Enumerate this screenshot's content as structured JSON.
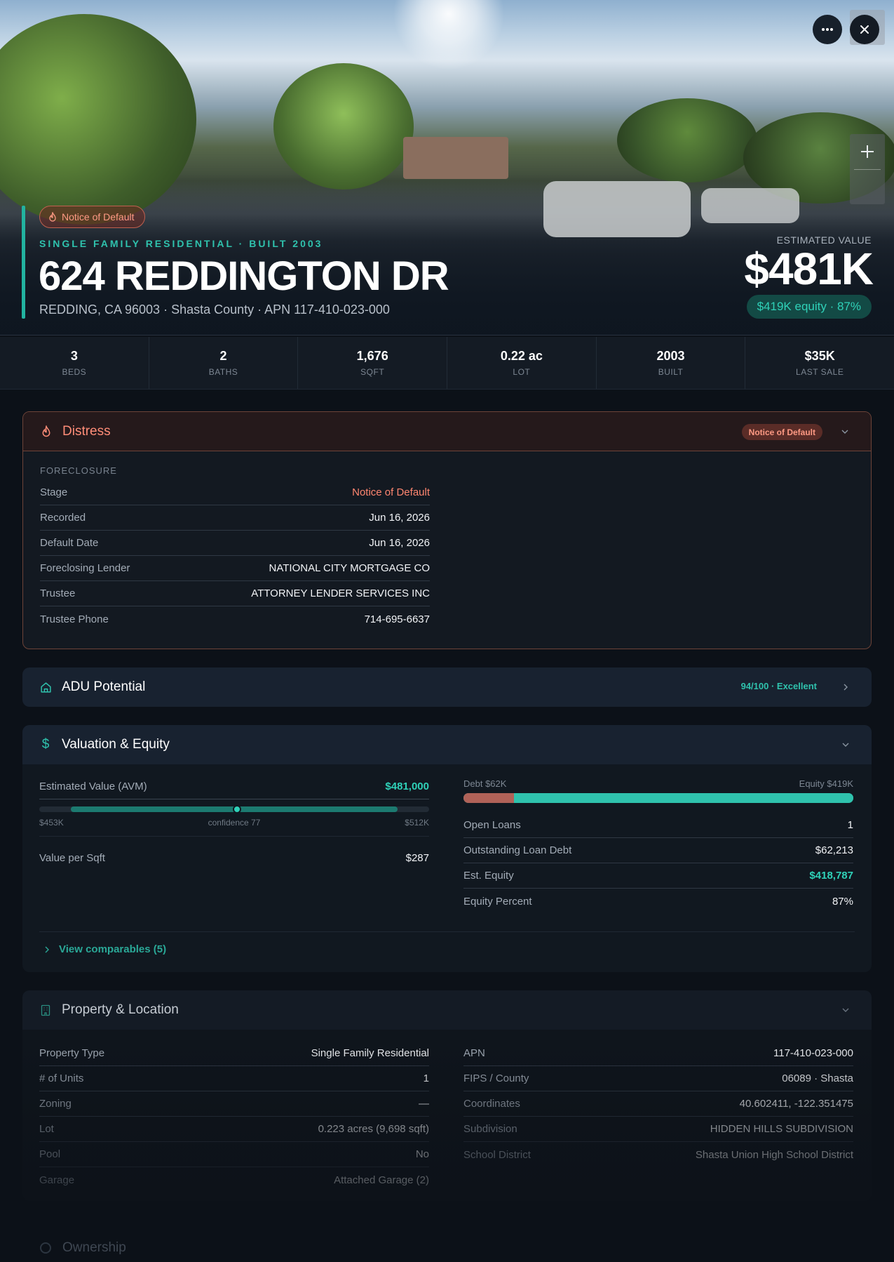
{
  "hero": {
    "distress_badge": "Notice of Default",
    "type_line": "SINGLE FAMILY RESIDENTIAL · BUILT 2003",
    "address": "624 REDDINGTON DR",
    "subline": "REDDING, CA 96003 · Shasta County · APN 117-410-023-000",
    "estimated_label": "ESTIMATED VALUE",
    "estimated_value": "$481K",
    "equity_pill": "$419K equity · 87%",
    "more_icon": "more-horizontal-icon",
    "close_icon": "close-icon",
    "zoom_in_icon": "plus-icon"
  },
  "stats": [
    {
      "value": "3",
      "label": "BEDS"
    },
    {
      "value": "2",
      "label": "BATHS"
    },
    {
      "value": "1,676",
      "label": "SQFT"
    },
    {
      "value": "0.22 ac",
      "label": "LOT"
    },
    {
      "value": "2003",
      "label": "BUILT"
    },
    {
      "value": "$35K",
      "label": "LAST SALE"
    }
  ],
  "distress": {
    "title": "Distress",
    "icon": "flame-icon",
    "badge": "Notice of Default",
    "section": "FORECLOSURE",
    "rows": [
      {
        "k": "Stage",
        "v": "Notice of Default"
      },
      {
        "k": "Recorded",
        "v": "Jun 16, 2026"
      },
      {
        "k": "Default Date",
        "v": "Jun 16, 2026"
      },
      {
        "k": "Foreclosing Lender",
        "v": "NATIONAL CITY MORTGAGE CO"
      },
      {
        "k": "Trustee",
        "v": "ATTORNEY LENDER SERVICES INC"
      },
      {
        "k": "Trustee Phone",
        "v": "714-695-6637"
      }
    ]
  },
  "adu": {
    "title": "ADU Potential",
    "icon": "home-icon",
    "score": "94/100 · Excellent"
  },
  "valuation": {
    "title": "Valuation & Equity",
    "icon": "dollar-icon",
    "avm_label": "Estimated Value (AVM)",
    "avm_value": "$481,000",
    "range_low": "$453K",
    "range_high": "$512K",
    "confidence": "confidence 77",
    "value_per_sqft_label": "Value per Sqft",
    "value_per_sqft": "$287",
    "debt_label": "Debt $62K",
    "equity_label": "Equity $419K",
    "equity_fraction": 0.87,
    "rows": [
      {
        "k": "Open Loans",
        "v": "1"
      },
      {
        "k": "Outstanding Loan Debt",
        "v": "$62,213"
      },
      {
        "k": "Est. Equity",
        "v": "$418,787"
      },
      {
        "k": "Equity Percent",
        "v": "87%"
      }
    ],
    "comparables_link": "View comparables (5)"
  },
  "property": {
    "title": "Property & Location",
    "icon": "building-icon",
    "left": [
      {
        "k": "Property Type",
        "v": "Single Family Residential"
      },
      {
        "k": "# of Units",
        "v": "1"
      },
      {
        "k": "Zoning",
        "v": "—"
      },
      {
        "k": "Lot",
        "v": "0.223 acres (9,698 sqft)"
      },
      {
        "k": "Pool",
        "v": "No"
      },
      {
        "k": "Garage",
        "v": "Attached Garage (2)"
      }
    ],
    "right": [
      {
        "k": "APN",
        "v": "117-410-023-000"
      },
      {
        "k": "FIPS / County",
        "v": "06089 · Shasta"
      },
      {
        "k": "Coordinates",
        "v": "40.602411, -122.351475"
      },
      {
        "k": "Subdivision",
        "v": "HIDDEN HILLS SUBDIVISION"
      },
      {
        "k": "School District",
        "v": "Shasta Union High School District"
      }
    ]
  },
  "ownership": {
    "title": "Ownership"
  },
  "colors": {
    "accent_teal": "#2fc2ad",
    "distress_red": "#ff8d78",
    "debt_bar": "#b06258"
  }
}
